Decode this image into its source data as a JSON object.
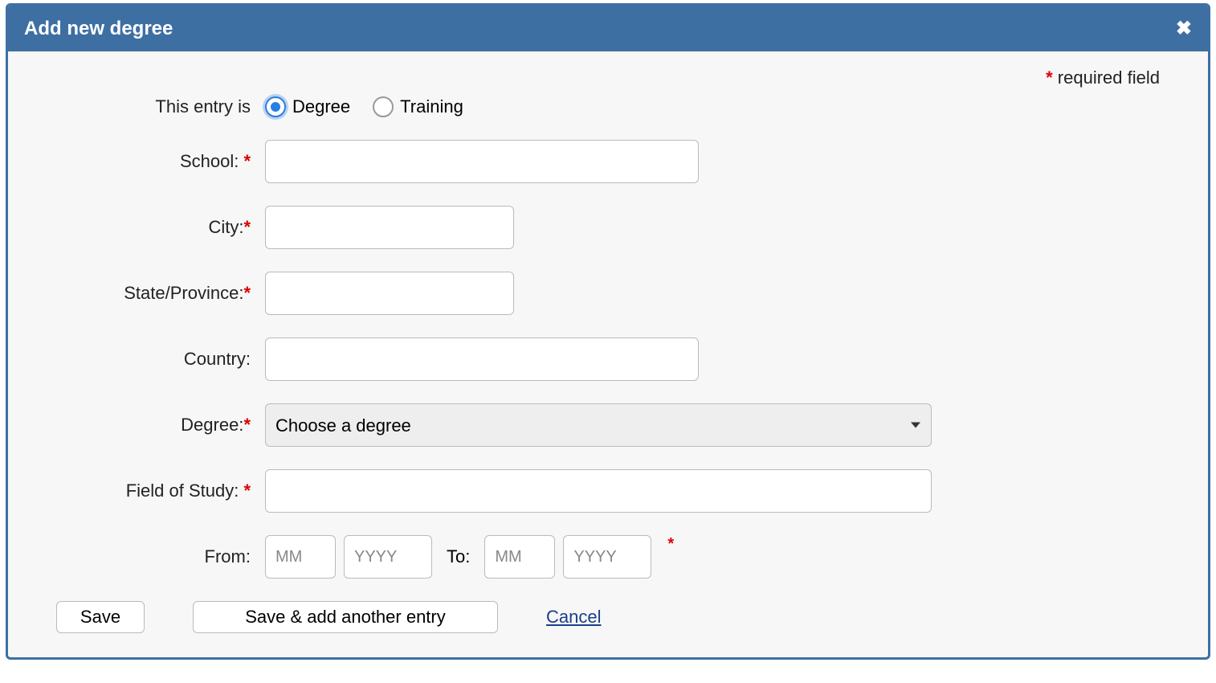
{
  "header": {
    "title": "Add new degree"
  },
  "requiredNote": {
    "text": " required field"
  },
  "form": {
    "entryIs": {
      "label": "This entry is",
      "options": {
        "degree": "Degree",
        "training": "Training"
      },
      "selected": "degree"
    },
    "school": {
      "label": "School: ",
      "value": ""
    },
    "city": {
      "label": "City:",
      "value": ""
    },
    "state": {
      "label": "State/Province:",
      "value": ""
    },
    "country": {
      "label": "Country:",
      "value": ""
    },
    "degree": {
      "label": "Degree:",
      "placeholder": "Choose a degree",
      "value": ""
    },
    "fieldOfStudy": {
      "label": "Field of Study: ",
      "value": ""
    },
    "dates": {
      "fromLabel": "From:",
      "toLabel": "To:",
      "fromMonth": "",
      "fromYear": "",
      "toMonth": "",
      "toYear": "",
      "mmPlaceholder": "MM",
      "yyyyPlaceholder": "YYYY"
    }
  },
  "actions": {
    "save": "Save",
    "saveAdd": "Save & add another entry",
    "cancel": "Cancel"
  }
}
